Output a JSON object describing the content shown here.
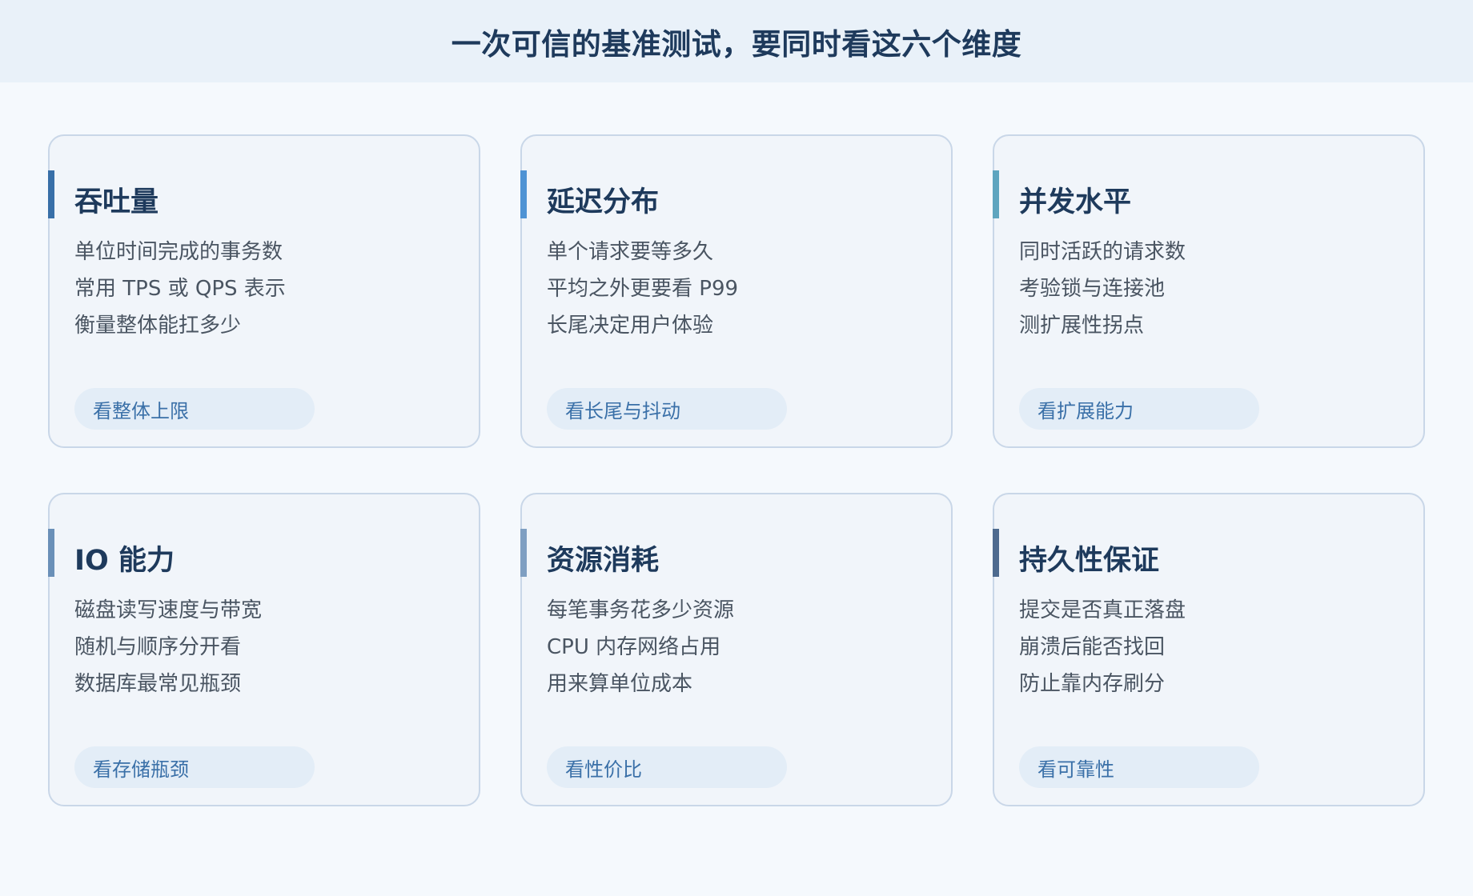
{
  "title": "一次可信的基准测试，要同时看这六个维度",
  "cards": [
    {
      "title": "吞吐量",
      "lines": [
        "单位时间完成的事务数",
        "常用 TPS 或 QPS 表示",
        "衡量整体能扛多少"
      ],
      "tag": "看整体上限",
      "accent": "#386fa8"
    },
    {
      "title": "延迟分布",
      "lines": [
        "单个请求要等多久",
        "平均之外更要看 P99",
        "长尾决定用户体验"
      ],
      "tag": "看长尾与抖动",
      "accent": "#4f93d4"
    },
    {
      "title": "并发水平",
      "lines": [
        "同时活跃的请求数",
        "考验锁与连接池",
        "测扩展性拐点"
      ],
      "tag": "看扩展能力",
      "accent": "#5ea5bf"
    },
    {
      "title": "IO 能力",
      "lines": [
        "磁盘读写速度与带宽",
        "随机与顺序分开看",
        "数据库最常见瓶颈"
      ],
      "tag": "看存储瓶颈",
      "accent": "#6a90b8"
    },
    {
      "title": "资源消耗",
      "lines": [
        "每笔事务花多少资源",
        "CPU 内存网络占用",
        "用来算单位成本"
      ],
      "tag": "看性价比",
      "accent": "#7f9fc2"
    },
    {
      "title": "持久性保证",
      "lines": [
        "提交是否真正落盘",
        "崩溃后能否找回",
        "防止靠内存刷分"
      ],
      "tag": "看可靠性",
      "accent": "#4e6b8f"
    }
  ]
}
